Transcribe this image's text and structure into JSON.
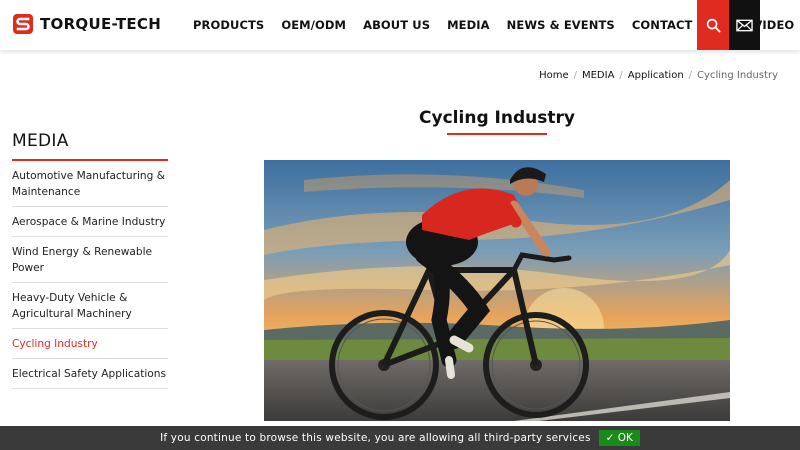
{
  "brand": {
    "name": "TORQUE-TECH",
    "accent": "#e02b20",
    "dark": "#111111"
  },
  "nav": {
    "items": [
      "PRODUCTS",
      "OEM/ODM",
      "ABOUT US",
      "MEDIA",
      "NEWS & EVENTS",
      "CONTACT US"
    ],
    "video_label": "VIDEO"
  },
  "icons": {
    "search": "search-icon",
    "mail": "mail-icon",
    "video": "youtube-icon"
  },
  "breadcrumb": [
    "Home",
    "MEDIA",
    "Application",
    "Cycling Industry"
  ],
  "sidebar": {
    "title": "MEDIA",
    "items": [
      "Automotive Manufacturing & Maintenance",
      "Aerospace & Marine Industry",
      "Wind Energy & Renewable Power",
      "Heavy-Duty Vehicle & Agricultural Machinery",
      "Cycling Industry",
      "Electrical Safety Applications"
    ],
    "active_index": 4
  },
  "main": {
    "title": "Cycling Industry"
  },
  "cookie": {
    "text": "If you continue to browse this website, you are allowing all third-party services",
    "ok_label": "✓ OK",
    "ok_color": "#1a8a1a"
  }
}
